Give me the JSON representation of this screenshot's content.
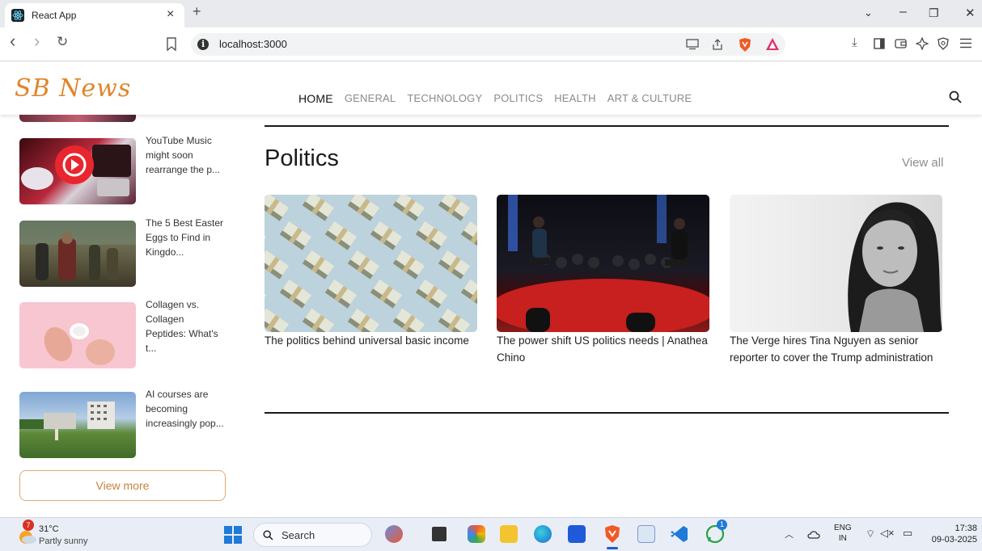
{
  "browser": {
    "tab_title": "React App",
    "tab_close": "×",
    "new_tab": "+",
    "url": "localhost:3000",
    "back": "‹",
    "forward": "›",
    "reload": "↻",
    "window_min": "–",
    "window_max": "❐",
    "window_close": "✕",
    "tab_search": "⌄"
  },
  "site": {
    "logo": "SB News",
    "nav": [
      "HOME",
      "GENERAL",
      "TECHNOLOGY",
      "POLITICS",
      "HEALTH",
      "ART & CULTURE"
    ],
    "active_nav": "HOME"
  },
  "sidebar": {
    "items": [
      {
        "text": "YouTube Music might soon rearrange the p..."
      },
      {
        "text": "The 5 Best Easter Eggs to Find in Kingdo..."
      },
      {
        "text": "Collagen vs. Collagen Peptides: What's t..."
      },
      {
        "text": "AI courses are becoming increasingly pop..."
      }
    ],
    "view_more": "View more"
  },
  "section": {
    "title": "Politics",
    "view_all": "View all",
    "cards": [
      {
        "title": "The politics behind universal basic income"
      },
      {
        "title": "The power shift US politics needs | Anathea Chino"
      },
      {
        "title": "The Verge hires Tina Nguyen as senior reporter to cover the Trump administration"
      }
    ]
  },
  "taskbar": {
    "weather_temp": "31°C",
    "weather_desc": "Partly sunny",
    "weather_badge": "7",
    "search_label": "Search",
    "lang_top": "ENG",
    "lang_bottom": "IN",
    "time": "17:38",
    "date": "09-03-2025",
    "whatsapp_badge": "1"
  },
  "colors": {
    "accent": "#e0852a",
    "brave": "#f15a24"
  }
}
